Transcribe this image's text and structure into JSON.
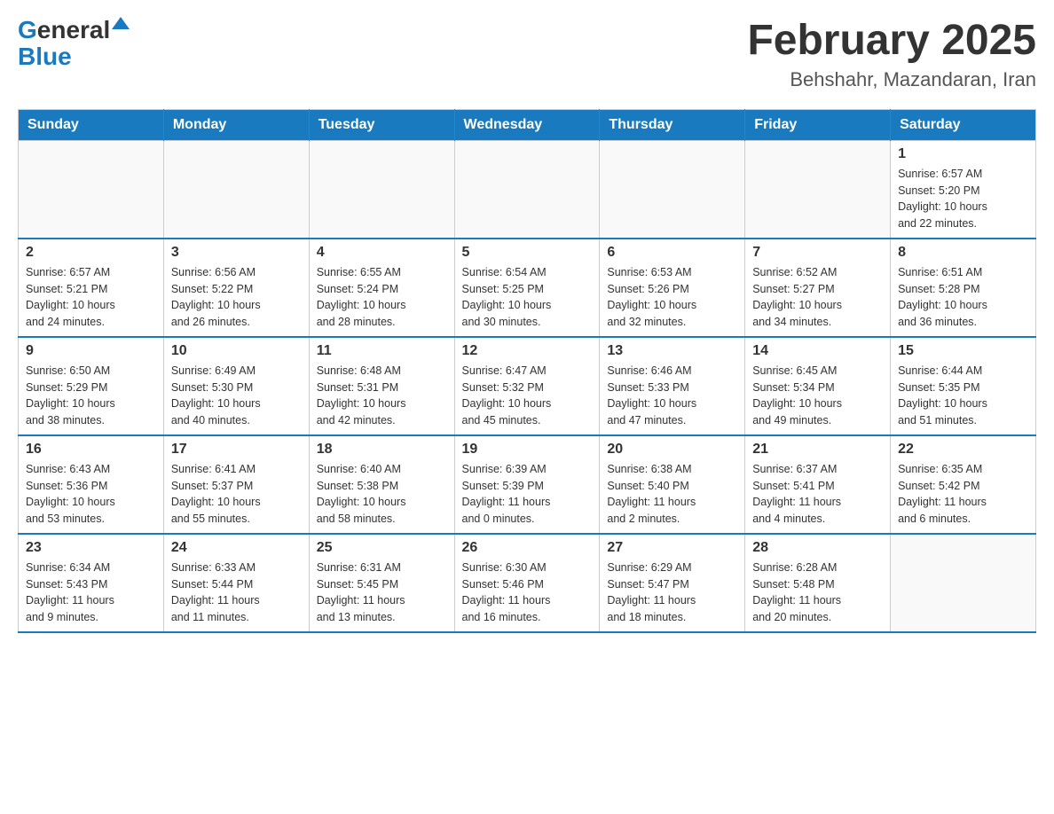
{
  "header": {
    "logo": {
      "general": "General",
      "blue": "Blue",
      "triangle": "▲"
    },
    "title": "February 2025",
    "subtitle": "Behshahr, Mazandaran, Iran"
  },
  "days_of_week": [
    "Sunday",
    "Monday",
    "Tuesday",
    "Wednesday",
    "Thursday",
    "Friday",
    "Saturday"
  ],
  "weeks": [
    [
      {
        "day": "",
        "info": ""
      },
      {
        "day": "",
        "info": ""
      },
      {
        "day": "",
        "info": ""
      },
      {
        "day": "",
        "info": ""
      },
      {
        "day": "",
        "info": ""
      },
      {
        "day": "",
        "info": ""
      },
      {
        "day": "1",
        "info": "Sunrise: 6:57 AM\nSunset: 5:20 PM\nDaylight: 10 hours\nand 22 minutes."
      }
    ],
    [
      {
        "day": "2",
        "info": "Sunrise: 6:57 AM\nSunset: 5:21 PM\nDaylight: 10 hours\nand 24 minutes."
      },
      {
        "day": "3",
        "info": "Sunrise: 6:56 AM\nSunset: 5:22 PM\nDaylight: 10 hours\nand 26 minutes."
      },
      {
        "day": "4",
        "info": "Sunrise: 6:55 AM\nSunset: 5:24 PM\nDaylight: 10 hours\nand 28 minutes."
      },
      {
        "day": "5",
        "info": "Sunrise: 6:54 AM\nSunset: 5:25 PM\nDaylight: 10 hours\nand 30 minutes."
      },
      {
        "day": "6",
        "info": "Sunrise: 6:53 AM\nSunset: 5:26 PM\nDaylight: 10 hours\nand 32 minutes."
      },
      {
        "day": "7",
        "info": "Sunrise: 6:52 AM\nSunset: 5:27 PM\nDaylight: 10 hours\nand 34 minutes."
      },
      {
        "day": "8",
        "info": "Sunrise: 6:51 AM\nSunset: 5:28 PM\nDaylight: 10 hours\nand 36 minutes."
      }
    ],
    [
      {
        "day": "9",
        "info": "Sunrise: 6:50 AM\nSunset: 5:29 PM\nDaylight: 10 hours\nand 38 minutes."
      },
      {
        "day": "10",
        "info": "Sunrise: 6:49 AM\nSunset: 5:30 PM\nDaylight: 10 hours\nand 40 minutes."
      },
      {
        "day": "11",
        "info": "Sunrise: 6:48 AM\nSunset: 5:31 PM\nDaylight: 10 hours\nand 42 minutes."
      },
      {
        "day": "12",
        "info": "Sunrise: 6:47 AM\nSunset: 5:32 PM\nDaylight: 10 hours\nand 45 minutes."
      },
      {
        "day": "13",
        "info": "Sunrise: 6:46 AM\nSunset: 5:33 PM\nDaylight: 10 hours\nand 47 minutes."
      },
      {
        "day": "14",
        "info": "Sunrise: 6:45 AM\nSunset: 5:34 PM\nDaylight: 10 hours\nand 49 minutes."
      },
      {
        "day": "15",
        "info": "Sunrise: 6:44 AM\nSunset: 5:35 PM\nDaylight: 10 hours\nand 51 minutes."
      }
    ],
    [
      {
        "day": "16",
        "info": "Sunrise: 6:43 AM\nSunset: 5:36 PM\nDaylight: 10 hours\nand 53 minutes."
      },
      {
        "day": "17",
        "info": "Sunrise: 6:41 AM\nSunset: 5:37 PM\nDaylight: 10 hours\nand 55 minutes."
      },
      {
        "day": "18",
        "info": "Sunrise: 6:40 AM\nSunset: 5:38 PM\nDaylight: 10 hours\nand 58 minutes."
      },
      {
        "day": "19",
        "info": "Sunrise: 6:39 AM\nSunset: 5:39 PM\nDaylight: 11 hours\nand 0 minutes."
      },
      {
        "day": "20",
        "info": "Sunrise: 6:38 AM\nSunset: 5:40 PM\nDaylight: 11 hours\nand 2 minutes."
      },
      {
        "day": "21",
        "info": "Sunrise: 6:37 AM\nSunset: 5:41 PM\nDaylight: 11 hours\nand 4 minutes."
      },
      {
        "day": "22",
        "info": "Sunrise: 6:35 AM\nSunset: 5:42 PM\nDaylight: 11 hours\nand 6 minutes."
      }
    ],
    [
      {
        "day": "23",
        "info": "Sunrise: 6:34 AM\nSunset: 5:43 PM\nDaylight: 11 hours\nand 9 minutes."
      },
      {
        "day": "24",
        "info": "Sunrise: 6:33 AM\nSunset: 5:44 PM\nDaylight: 11 hours\nand 11 minutes."
      },
      {
        "day": "25",
        "info": "Sunrise: 6:31 AM\nSunset: 5:45 PM\nDaylight: 11 hours\nand 13 minutes."
      },
      {
        "day": "26",
        "info": "Sunrise: 6:30 AM\nSunset: 5:46 PM\nDaylight: 11 hours\nand 16 minutes."
      },
      {
        "day": "27",
        "info": "Sunrise: 6:29 AM\nSunset: 5:47 PM\nDaylight: 11 hours\nand 18 minutes."
      },
      {
        "day": "28",
        "info": "Sunrise: 6:28 AM\nSunset: 5:48 PM\nDaylight: 11 hours\nand 20 minutes."
      },
      {
        "day": "",
        "info": ""
      }
    ]
  ]
}
